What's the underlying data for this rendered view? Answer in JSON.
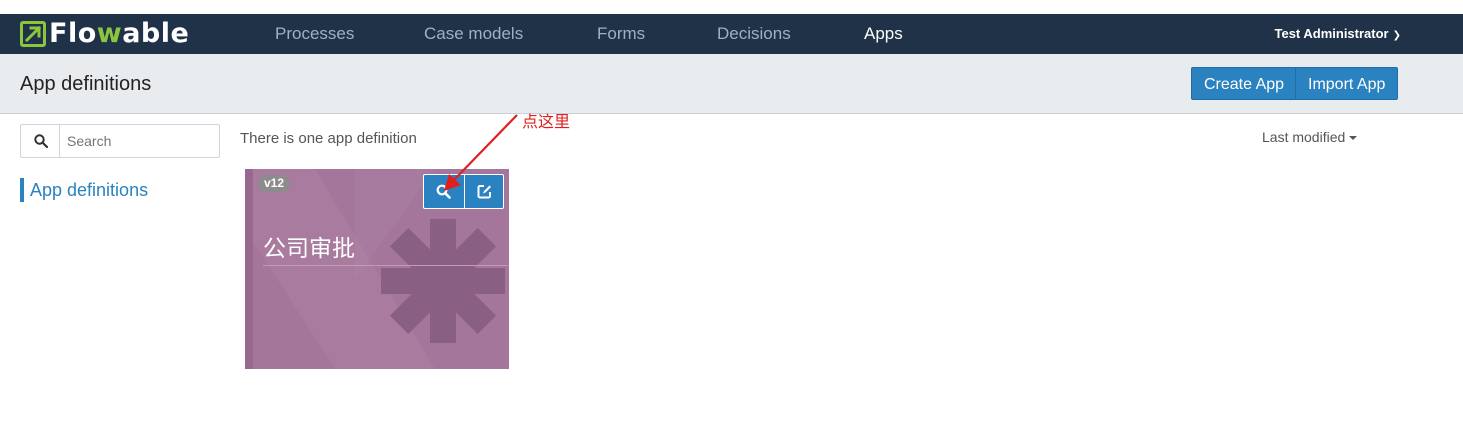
{
  "brand": {
    "logo_text_left": "Flo",
    "logo_text_accent": "w",
    "logo_text_right": "able",
    "accent_color": "#8cc63f",
    "navbar_color": "#1f3248"
  },
  "nav": {
    "items": [
      {
        "label": "Processes"
      },
      {
        "label": "Case models"
      },
      {
        "label": "Forms"
      },
      {
        "label": "Decisions"
      },
      {
        "label": "Apps"
      }
    ],
    "active": "Apps",
    "user_name": "Test Administrator"
  },
  "subheader": {
    "title": "App definitions",
    "create_button": "Create App",
    "import_button": "Import App"
  },
  "sidebar": {
    "search_placeholder": "Search",
    "link_label": "App definitions"
  },
  "list": {
    "summary": "There is one app definition",
    "sort_label": "Last modified"
  },
  "apps": [
    {
      "title": "公司审批",
      "version": "v12",
      "color": "#a4769b",
      "icon": "asterisk-icon"
    }
  ],
  "annotation": {
    "text": "点这里",
    "color": "#e02020"
  }
}
